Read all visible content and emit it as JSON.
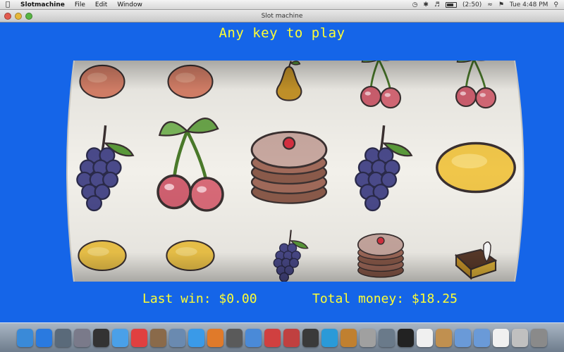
{
  "menubar": {
    "app_name": "Slotmachine",
    "items": [
      "File",
      "Edit",
      "Window"
    ],
    "battery_text": "(2:50)",
    "clock": "Tue 4:48 PM"
  },
  "window": {
    "title": "Slot machine"
  },
  "game": {
    "prompt": "Any key to play",
    "last_win": "Last win: $0.00",
    "total_money": "Total money: $18.25"
  },
  "reels": [
    [
      "orange",
      "grapes",
      "lemon"
    ],
    [
      "orange",
      "cherry",
      "lemon"
    ],
    [
      "pear",
      "cake",
      "grapes"
    ],
    [
      "cherry",
      "grapes",
      "cake"
    ],
    [
      "cherry",
      "lemon",
      "gold-bar"
    ]
  ],
  "colors": {
    "background": "#1565e8",
    "text": "#ffff33"
  },
  "dock": {
    "icons": [
      "finder-icon",
      "app-store-icon",
      "time-machine-icon",
      "system-preferences-icon",
      "dashboard-icon",
      "ichat-icon",
      "calendar-icon",
      "photo-icon",
      "preview-icon",
      "safari-icon",
      "firefox-icon",
      "photo-booth-icon",
      "iphoto-icon",
      "ical-icon",
      "itunes-icon",
      "dvd-player-icon",
      "itunes-store-icon",
      "garageband-icon",
      "aperture-icon",
      "image-capture-icon",
      "terminal-icon",
      "textedit-icon",
      "tools-icon",
      "folder-icon",
      "folder-icon",
      "document-icon",
      "mail-icon",
      "trash-icon"
    ]
  }
}
